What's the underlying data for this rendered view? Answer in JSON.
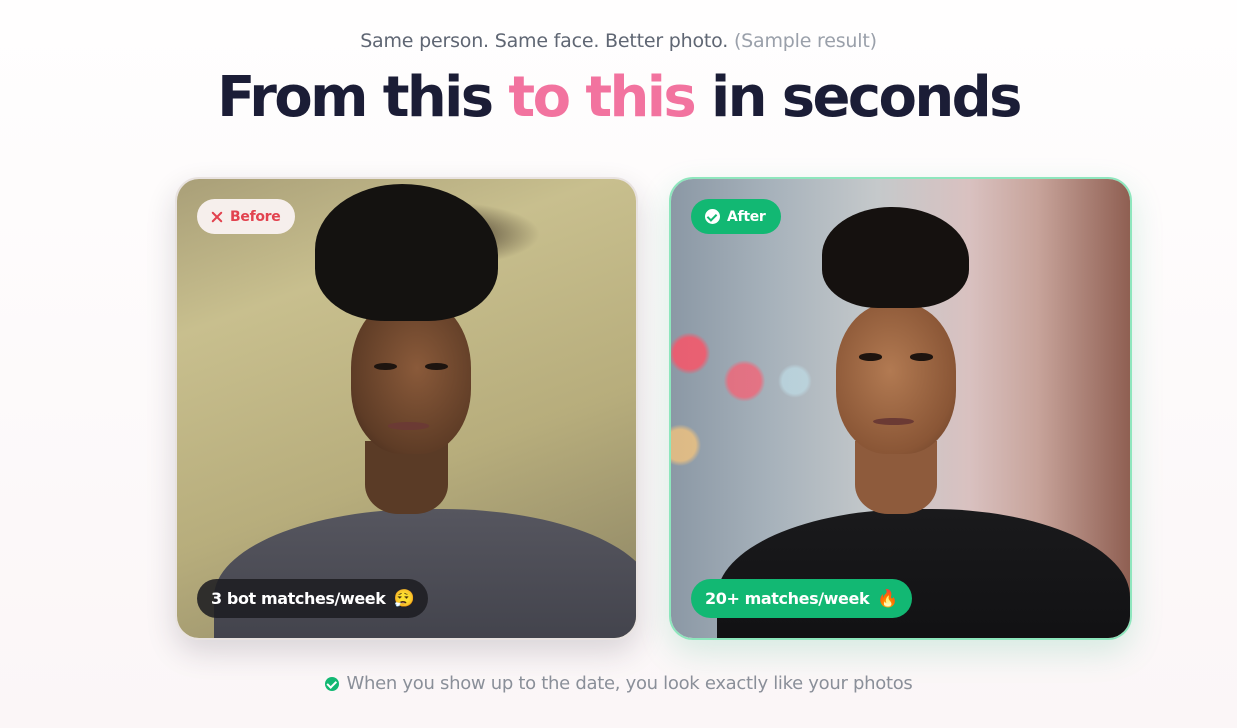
{
  "header": {
    "subtitle": "Same person. Same face. Better photo.",
    "subtitle_note": "(Sample result)",
    "headline_part1": "From this ",
    "headline_highlight": "to this",
    "headline_part2": " in seconds"
  },
  "before_card": {
    "tag_label": "Before",
    "stat_text": "3 bot matches/week",
    "stat_emoji": "😮‍💨",
    "tag_icon": "close-icon"
  },
  "after_card": {
    "tag_label": "After",
    "stat_text": "20+ matches/week",
    "stat_emoji": "🔥",
    "tag_icon": "check-circle-icon"
  },
  "footer": {
    "note": "When you show up to the date, you look exactly like your photos",
    "icon": "check-circle-icon"
  },
  "colors": {
    "accent_pink": "#f2739f",
    "success_green": "#12b873",
    "heading": "#1b1d36",
    "danger_red": "#e2434f"
  }
}
